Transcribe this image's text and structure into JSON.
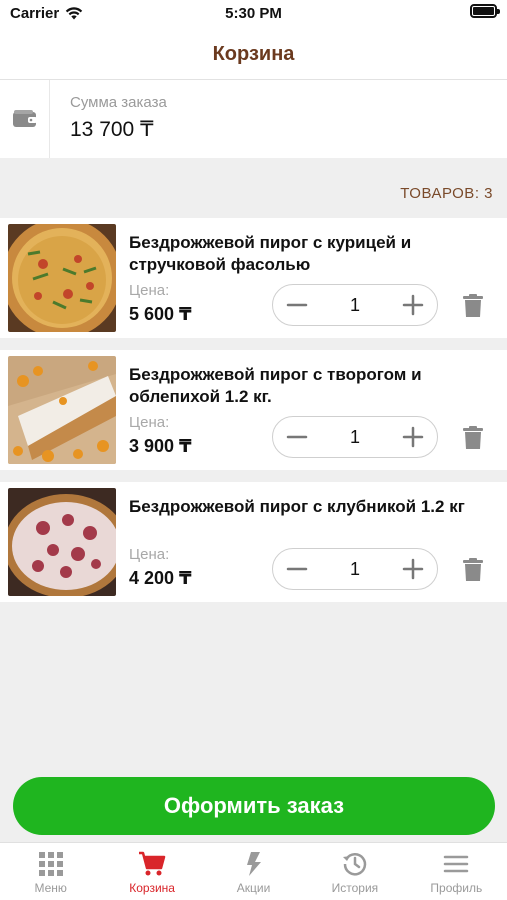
{
  "status_bar": {
    "carrier": "Carrier",
    "time": "5:30 PM",
    "battery_level": 1.0
  },
  "header": {
    "title": "Корзина"
  },
  "summary": {
    "icon": "wallet-icon",
    "label": "Сумма заказа",
    "value": "13 700 ₸"
  },
  "cart": {
    "count_text": "ТОВАРОВ: 3",
    "items": [
      {
        "name": "Бездрожжевой пирог с курицей и стручковой фасолью",
        "price_label": "Цена:",
        "price": "5 600 ₸",
        "quantity": "1",
        "image": "chicken-pie-image"
      },
      {
        "name": "Бездрожжевой пирог с творогом и облепихой 1.2 кг.",
        "price_label": "Цена:",
        "price": "3 900 ₸",
        "quantity": "1",
        "image": "cottage-cheese-pie-image"
      },
      {
        "name": "Бездрожжевой пирог с клубникой 1.2 кг",
        "price_label": "Цена:",
        "price": "4 200 ₸",
        "quantity": "1",
        "image": "strawberry-pie-image"
      }
    ]
  },
  "order_button": {
    "label": "Оформить заказ"
  },
  "tabs": [
    {
      "label": "Меню",
      "icon": "grid-icon",
      "active": false
    },
    {
      "label": "Корзина",
      "icon": "cart-icon",
      "active": true
    },
    {
      "label": "Акции",
      "icon": "lightning-icon",
      "active": false
    },
    {
      "label": "История",
      "icon": "history-icon",
      "active": false
    },
    {
      "label": "Профиль",
      "icon": "menu-icon",
      "active": false
    }
  ],
  "colors": {
    "brand_brown": "#6b3a1f",
    "accent_green": "#1fb51f",
    "active_tab_red": "#d9252a",
    "inactive_gray": "#9a9a9a"
  }
}
